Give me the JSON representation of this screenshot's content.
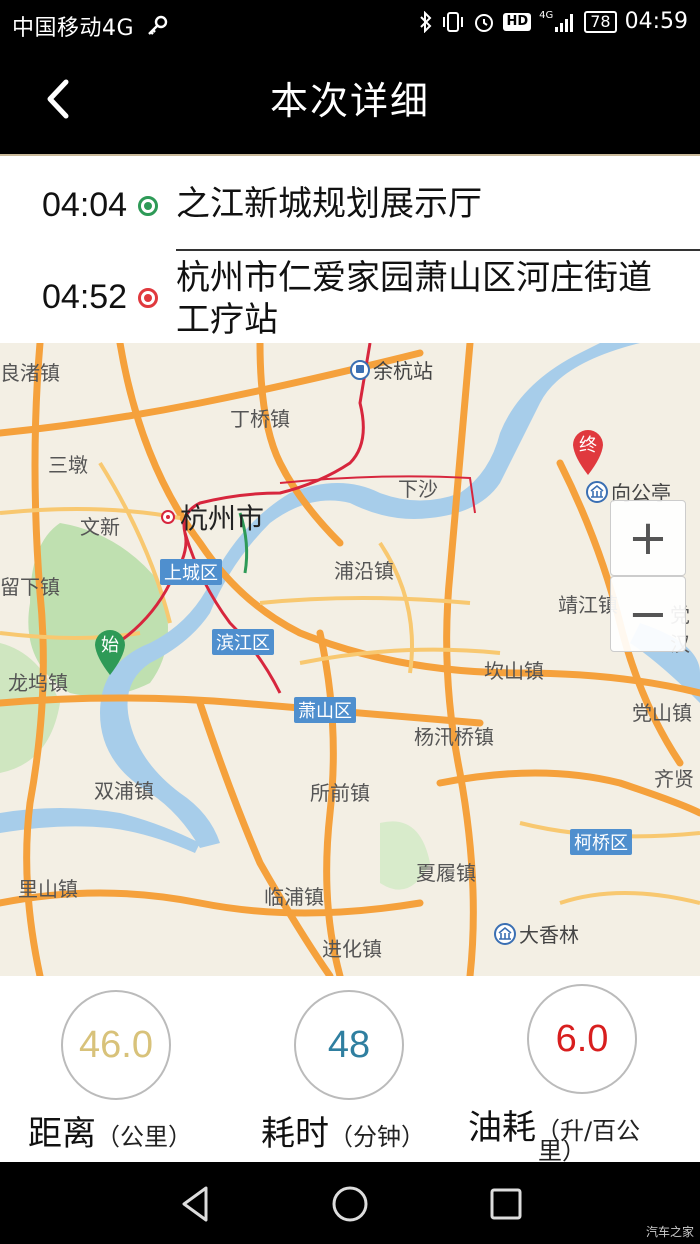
{
  "status_bar": {
    "carrier": "中国移动4G",
    "network": "4G",
    "battery": "78",
    "time": "04:59"
  },
  "header": {
    "title": "本次详细"
  },
  "route": {
    "start": {
      "time": "04:04",
      "place": "之江新城规划展示厅",
      "color": "#2e9a57"
    },
    "end": {
      "time": "04:52",
      "place_line1": "杭州市仁爱家园萧山区河庄街道",
      "place_line2": "工疗站",
      "color": "#e0393e"
    }
  },
  "map": {
    "labels": {
      "liangzhu": "良渚镇",
      "yuhang": "余杭站",
      "dingqiao": "丁桥镇",
      "sandun": "三墩",
      "xiasha": "下沙",
      "wenxin": "文新",
      "hangzhou": "杭州市",
      "liuxia": "留下镇",
      "shangcheng": "上城区",
      "puyan": "浦沿镇",
      "jingjiang": "靖江镇",
      "dangxi": "党汉",
      "binjiang": "滨江区",
      "longwu": "龙坞镇",
      "kanshan": "坎山镇",
      "dangshan": "党山镇",
      "xiaoshan": "萧山区",
      "yangxunqiao": "杨汛桥镇",
      "shuangpu": "双浦镇",
      "suoqian": "所前镇",
      "qixian": "齐贤",
      "keqiao": "柯桥区",
      "xialv": "夏履镇",
      "lishan": "里山镇",
      "linpu": "临浦镇",
      "daxianglin": "大香林",
      "jinhua": "进化镇",
      "xianggong": "向公亭",
      "start_marker": "始",
      "end_marker": "终"
    },
    "zoom_in": "+",
    "zoom_out": "−"
  },
  "stats": {
    "distance": {
      "value": "46.0",
      "label": "距离",
      "unit": "（公里）",
      "color": "#d8c27a"
    },
    "duration": {
      "value": "48",
      "label": "耗时",
      "unit": "（分钟）",
      "color": "#2f7fa0"
    },
    "fuel": {
      "value": "6.0",
      "label": "油耗",
      "unit": "（升/百公",
      "unit2": "里）",
      "color": "#d81e1e"
    }
  },
  "watermark": "汽车之家"
}
